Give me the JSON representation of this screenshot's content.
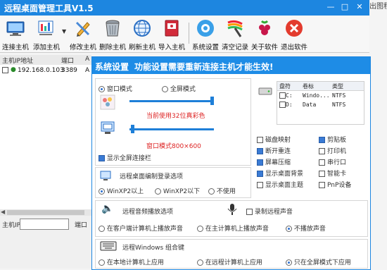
{
  "app": {
    "title": "远程桌面管理工具V1.5",
    "window_controls": [
      "minimize",
      "maximize",
      "close"
    ],
    "side_text": "出图程"
  },
  "toolbar": {
    "buttons": [
      {
        "label": "连接主机",
        "icon": "monitor-connect-icon"
      },
      {
        "label": "添加主机",
        "icon": "add-host-icon"
      },
      {
        "label": "修改主机",
        "icon": "edit-pencil-icon"
      },
      {
        "label": "删除主机",
        "icon": "trash-icon"
      },
      {
        "label": "刷新主机",
        "icon": "refresh-globe-icon"
      },
      {
        "label": "导入主机",
        "icon": "import-book-icon"
      },
      {
        "label": "系统设置",
        "icon": "settings-gear-icon"
      },
      {
        "label": "清空记录",
        "icon": "clear-wand-icon"
      },
      {
        "label": "关于软件",
        "icon": "about-raspberry-icon"
      },
      {
        "label": "退出软件",
        "icon": "exit-close-icon"
      }
    ]
  },
  "host_list": {
    "columns": [
      "主机IP地址",
      "端口",
      "A"
    ],
    "rows": [
      {
        "checked": false,
        "ip": "192.168.0.103",
        "port": "3389",
        "extra": "A"
      }
    ]
  },
  "bottom": {
    "ip_label": "主机IP:",
    "ip_value": "",
    "port_label": "端口"
  },
  "settings_dialog": {
    "title": "系统设置",
    "subtitle": "功能设置需要重新连接主机才能生效!",
    "display": {
      "window_mode": "窗口模式",
      "fullscreen_mode": "全屏模式",
      "selected": "window",
      "color_depth": "当前使用32位真彩色",
      "color_level": 1.0,
      "window_size": "窗口模式800×600",
      "window_size_level": 0.02,
      "show_fullscreen_bar": "显示全屏连接栏",
      "show_fullscreen_bar_checked": true
    },
    "drives": {
      "columns": [
        "盘符",
        "卷标",
        "类型"
      ],
      "rows": [
        {
          "letter": "C:",
          "label": "Windo...",
          "type": "NTFS",
          "checked": false
        },
        {
          "letter": "D:",
          "label": "Data",
          "type": "NTFS",
          "checked": false
        }
      ]
    },
    "options": [
      {
        "label": "磁盘映射",
        "checked": false
      },
      {
        "label": "剪贴板",
        "checked": true
      },
      {
        "label": "断开重连",
        "checked": true
      },
      {
        "label": "打印机",
        "checked": false
      },
      {
        "label": "屏幕压缩",
        "checked": true
      },
      {
        "label": "串行口",
        "checked": false
      },
      {
        "label": "显示桌面背景",
        "checked": true
      },
      {
        "label": "智能卡",
        "checked": false
      },
      {
        "label": "显示桌面主题",
        "checked": false
      },
      {
        "label": "PnP设备",
        "checked": false
      }
    ],
    "record": {
      "title": "远程桌面编制登录选项",
      "choices": [
        "WinXP2以上",
        "WinXP2以下",
        "不使用"
      ],
      "selected": 0
    },
    "audio": {
      "title": "远程音频播放选项",
      "record_label": "录制远程声音",
      "record_checked": false,
      "choices": [
        "在客户端计算机上播放声音",
        "在主计算机上播放声音",
        "不播放声音"
      ],
      "selected": 2
    },
    "keys": {
      "title": "远程Windows 组合键",
      "choices": [
        "在本地计算机上应用",
        "在远程计算机上应用",
        "只在全屏模式下应用"
      ],
      "selected": 2
    }
  },
  "colors": {
    "titlebar": "#1d86e0",
    "accent": "#1e7fd8",
    "warning_text": "#dd2222"
  }
}
